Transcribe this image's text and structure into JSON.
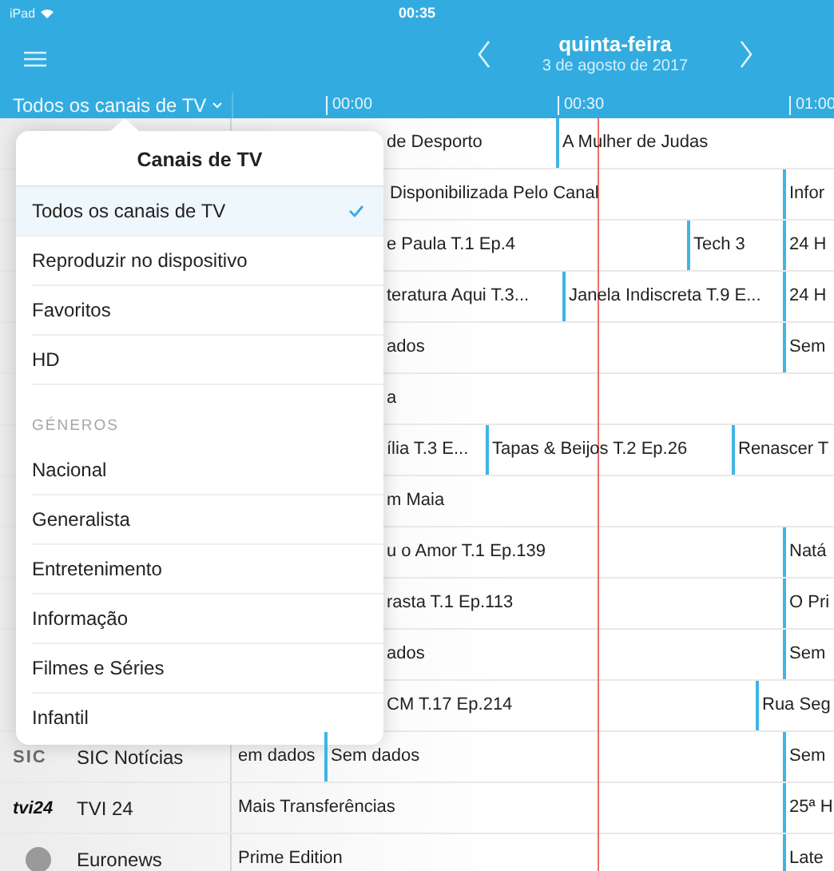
{
  "status_bar": {
    "device": "iPad",
    "time": "00:35"
  },
  "nav": {
    "day": "quinta-feira",
    "date": "3 de agosto de 2017"
  },
  "channel_filter": {
    "label": "Todos os canais de TV"
  },
  "timeline": {
    "labels": [
      "00:00",
      "00:30",
      "01:00"
    ]
  },
  "rows": [
    {
      "programs": [
        "de Desporto",
        "A Mulher de Judas"
      ]
    },
    {
      "programs": [
        "Disponibilizada Pelo Canal",
        "Infor"
      ]
    },
    {
      "programs": [
        "e Paula T.1 Ep.4",
        "Tech 3",
        "24 H"
      ]
    },
    {
      "programs": [
        "teratura Aqui T.3...",
        "Janela Indiscreta T.9 E...",
        "24 H"
      ]
    },
    {
      "programs": [
        "ados",
        "Sem"
      ]
    },
    {
      "programs": [
        "a"
      ]
    },
    {
      "programs": [
        "ília T.3 E...",
        "Tapas & Beijos T.2 Ep.26",
        "Renascer T"
      ]
    },
    {
      "programs": [
        "m Maia"
      ]
    },
    {
      "programs": [
        "u o Amor T.1 Ep.139",
        "Natá"
      ]
    },
    {
      "programs": [
        "rasta T.1 Ep.113",
        "O Pri"
      ]
    },
    {
      "programs": [
        "ados",
        "Sem"
      ]
    },
    {
      "programs": [
        "CM T.17 Ep.214",
        "Rua Seg"
      ]
    },
    {
      "channel": {
        "name": "SIC Notícias",
        "kind": "sic",
        "logo": "SIC"
      },
      "programs": [
        "em dados",
        "Sem dados",
        "Sem"
      ]
    },
    {
      "channel": {
        "name": "TVI 24",
        "kind": "tvi",
        "logo": "tvi24"
      },
      "programs": [
        "Mais Transferências",
        "25ª H"
      ]
    },
    {
      "channel": {
        "name": "Euronews",
        "kind": "circle"
      },
      "programs": [
        "Prime Edition",
        "Late"
      ]
    }
  ],
  "popover": {
    "title": "Canais de TV",
    "items": [
      {
        "label": "Todos os canais de TV",
        "selected": true
      },
      {
        "label": "Reproduzir no dispositivo",
        "selected": false
      },
      {
        "label": "Favoritos",
        "selected": false
      },
      {
        "label": "HD",
        "selected": false
      }
    ],
    "section": "GÉNEROS",
    "genres": [
      {
        "label": "Nacional",
        "selected": false
      },
      {
        "label": "Generalista",
        "selected": false
      },
      {
        "label": "Entretenimento",
        "selected": false
      },
      {
        "label": "Informação",
        "selected": false
      },
      {
        "label": "Filmes e Séries",
        "selected": false
      },
      {
        "label": "Infantil",
        "selected": false
      }
    ]
  }
}
